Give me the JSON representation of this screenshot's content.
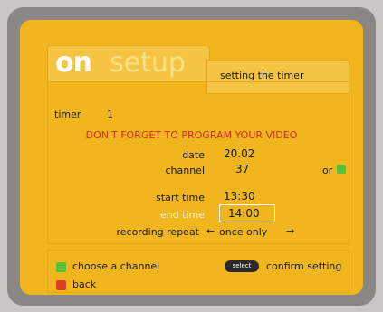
{
  "header": {
    "logo_on": "on",
    "logo_setup": "setup",
    "title": "setting the timer"
  },
  "timer": {
    "label": "timer",
    "number": "1"
  },
  "warning": "DON'T FORGET TO PROGRAM YOUR VIDEO",
  "fields": {
    "date_label": "date",
    "date_value": "20.02",
    "channel_label": "channel",
    "channel_value": "37",
    "or_label": "or",
    "start_label": "start time",
    "start_value": "13:30",
    "end_label": "end time",
    "end_value": "14:00",
    "repeat_label": "recording repeat",
    "repeat_value": "once only",
    "arrow_left": "←",
    "arrow_right": "→"
  },
  "footer": {
    "green_label": "choose a channel",
    "select_button": "select",
    "select_label": "confirm setting",
    "red_label": "back"
  },
  "colors": {
    "background": "#f1b51e",
    "warning": "#d0301a",
    "green": "#5bbf3a",
    "red": "#d9421f",
    "highlight": "#fff5c8"
  }
}
